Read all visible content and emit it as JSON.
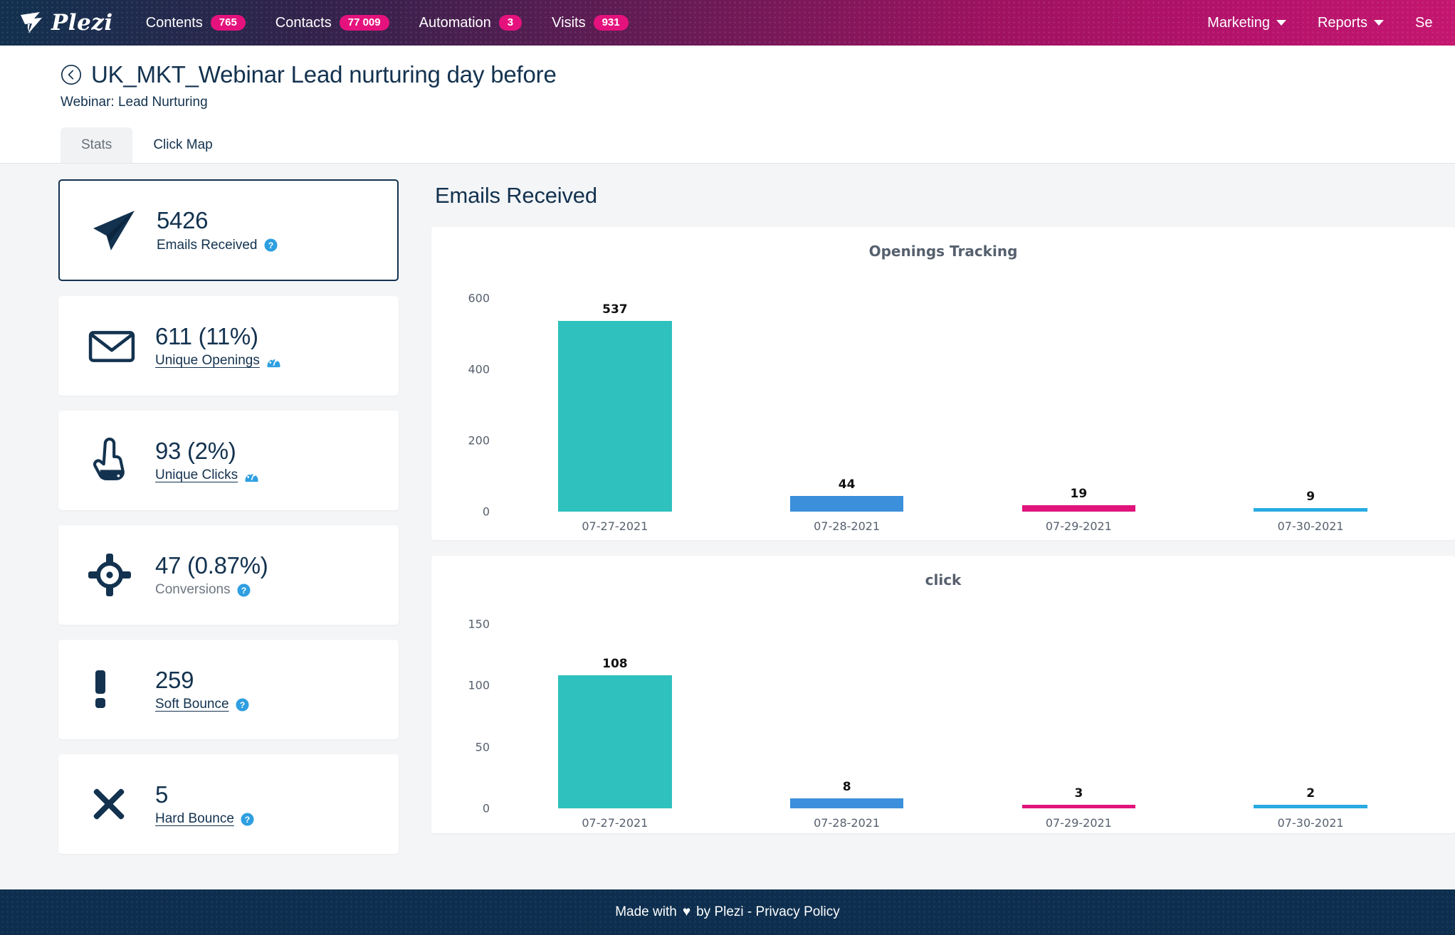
{
  "topnav": {
    "logo": {
      "word": "Plezi",
      "icon": "plezi-bird-logo"
    },
    "items": [
      {
        "label": "Contents",
        "badge": "765"
      },
      {
        "label": "Contacts",
        "badge": "77 009"
      },
      {
        "label": "Automation",
        "badge": "3"
      },
      {
        "label": "Visits",
        "badge": "931"
      }
    ],
    "right": [
      {
        "label": "Marketing",
        "caret": true
      },
      {
        "label": "Reports",
        "caret": true
      },
      {
        "label": "Se",
        "caret": false
      }
    ],
    "badge_color": "#e5127d"
  },
  "page": {
    "back_icon": "chevron-left-circle-icon",
    "title": "UK_MKT_Webinar Lead nurturing day before",
    "subtitle": "Webinar: Lead Nurturing",
    "tabs": [
      {
        "label": "Stats",
        "active": true
      },
      {
        "label": "Click Map",
        "active": false
      }
    ]
  },
  "stats": [
    {
      "icon": "paper-plane-icon",
      "value": "5426",
      "label": "Emails Received",
      "selected": true,
      "link": false,
      "muted": false,
      "trailing_icon": "help-circle-icon"
    },
    {
      "icon": "envelope-icon",
      "value": "611 (11%)",
      "label": "Unique Openings",
      "selected": false,
      "link": true,
      "muted": false,
      "trailing_icon": "gauge-icon"
    },
    {
      "icon": "pointing-hand-icon",
      "value": "93 (2%)",
      "label": "Unique Clicks",
      "selected": false,
      "link": true,
      "muted": false,
      "trailing_icon": "gauge-icon"
    },
    {
      "icon": "crosshair-target-icon",
      "value": "47 (0.87%)",
      "label": "Conversions",
      "selected": false,
      "link": false,
      "muted": true,
      "trailing_icon": "help-circle-icon"
    },
    {
      "icon": "exclamation-mark-icon",
      "value": "259",
      "label": "Soft Bounce",
      "selected": false,
      "link": true,
      "muted": false,
      "trailing_icon": "help-circle-icon"
    },
    {
      "icon": "cross-x-icon",
      "value": "5",
      "label": "Hard Bounce",
      "selected": false,
      "link": true,
      "muted": false,
      "trailing_icon": "help-circle-icon"
    }
  ],
  "content": {
    "heading": "Emails Received"
  },
  "chart_data": [
    {
      "type": "bar",
      "title": "Openings Tracking",
      "categories": [
        "07-27-2021",
        "07-28-2021",
        "07-29-2021",
        "07-30-2021"
      ],
      "values": [
        537,
        44,
        19,
        9
      ],
      "colors": [
        "#2fc1bd",
        "#3b8fdb",
        "#e0147b",
        "#29abe2"
      ],
      "xlabel": "",
      "ylabel": "",
      "ylim": [
        0,
        660
      ],
      "yticks": [
        0,
        200,
        400,
        600
      ],
      "grid": false,
      "legend": "none"
    },
    {
      "type": "bar",
      "title": "click",
      "categories": [
        "07-27-2021",
        "07-28-2021",
        "07-29-2021",
        "07-30-2021"
      ],
      "values": [
        108,
        8,
        3,
        2
      ],
      "colors": [
        "#2fc1bd",
        "#3b8fdb",
        "#e0147b",
        "#29abe2"
      ],
      "xlabel": "",
      "ylabel": "",
      "ylim": [
        0,
        165
      ],
      "yticks": [
        0,
        50,
        100,
        150
      ],
      "grid": false,
      "legend": "none"
    }
  ],
  "footer": {
    "prefix": "Made with",
    "heart": "♥",
    "suffix": "by Plezi - Privacy Policy"
  }
}
